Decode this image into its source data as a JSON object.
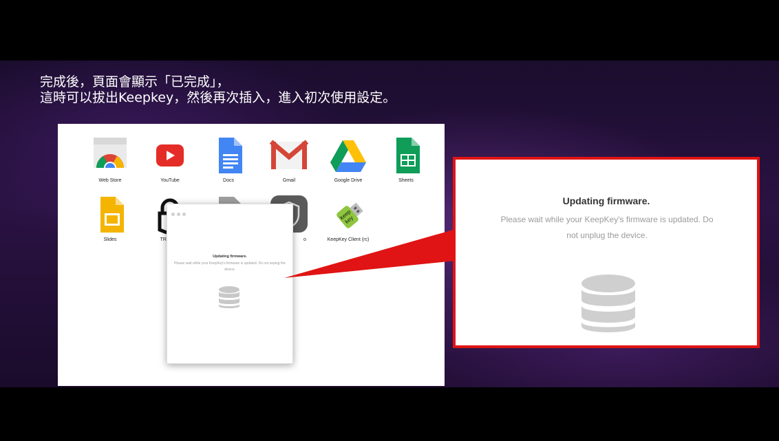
{
  "caption": {
    "line1": "完成後，頁面會顯示「已完成」，",
    "line2": "這時可以拔出Keepkey，然後再次插入，進入初次使用設定。"
  },
  "apps": [
    {
      "name": "Web Store",
      "icon": "chrome-web-store-icon"
    },
    {
      "name": "YouTube",
      "icon": "youtube-icon"
    },
    {
      "name": "Docs",
      "icon": "google-docs-icon"
    },
    {
      "name": "Gmail",
      "icon": "gmail-icon"
    },
    {
      "name": "Google Drive",
      "icon": "google-drive-icon"
    },
    {
      "name": "Sheets",
      "icon": "google-sheets-icon"
    },
    {
      "name": "Slides",
      "icon": "google-slides-icon"
    },
    {
      "name": "TREZOR",
      "icon": "trezor-icon"
    },
    {
      "name": "",
      "icon": "hidden-app-icon"
    },
    {
      "name": "o",
      "icon": "shield-app-icon"
    },
    {
      "name": "KeepKey Client (rc)",
      "icon": "keepkey-icon"
    }
  ],
  "dialog_small": {
    "title": "Updating firmware.",
    "message": "Please wait while your KeepKey's firmware is updated. Do not unplug the device."
  },
  "dialog_zoomed": {
    "title": "Updating firmware.",
    "message_line1": "Please wait while your KeepKey's firmware is updated. Do",
    "message_line2": "not unplug the device."
  },
  "colors": {
    "highlight_border": "#e01414",
    "background_purple": "#2a1242"
  }
}
